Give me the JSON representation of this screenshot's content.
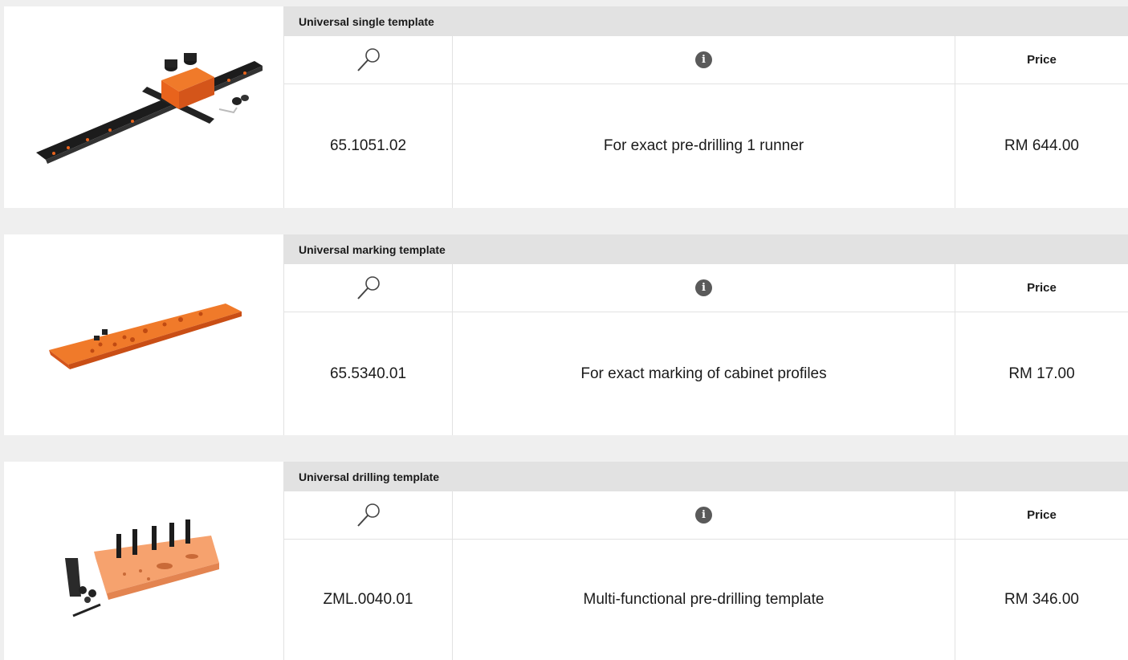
{
  "products": [
    {
      "image": "orange-black-single-runner-template",
      "title": "Universal single template",
      "header": {
        "search_icon": "magnifier-icon",
        "info_icon": "info-icon",
        "info_glyph": "i",
        "price_label": "Price"
      },
      "article_no": "65.1051.02",
      "description": "For exact pre-drilling 1 runner",
      "price": "RM 644.00"
    },
    {
      "image": "orange-marking-template-plate",
      "title": "Universal marking template",
      "header": {
        "search_icon": "magnifier-icon",
        "info_icon": "info-icon",
        "info_glyph": "i",
        "price_label": "Price"
      },
      "article_no": "65.5340.01",
      "description": "For exact marking of cabinet profiles",
      "price": "RM 17.00"
    },
    {
      "image": "orange-drilling-template-with-accessories",
      "title": "Universal drilling template",
      "header": {
        "search_icon": "magnifier-icon",
        "info_icon": "info-icon",
        "info_glyph": "i",
        "price_label": "Price"
      },
      "article_no": "ZML.0040.01",
      "description": "Multi-functional pre-drilling template",
      "price": "RM 346.00"
    }
  ],
  "colors": {
    "orange": "#e8631c",
    "black": "#1c1c1c",
    "header_bg": "#e2e2e2"
  }
}
